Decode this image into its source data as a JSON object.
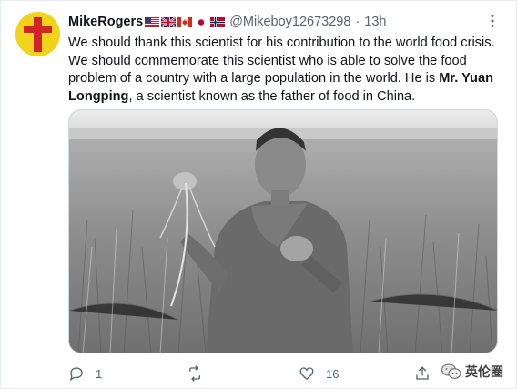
{
  "tweet": {
    "display_name": "MikeRogers",
    "flags": [
      "us-flag",
      "uk-flag",
      "canada-flag",
      "japan-flag",
      "norway-flag"
    ],
    "handle": "@Mikeboy12673298",
    "separator": "·",
    "time": "13h",
    "text_part1": "We should thank this scientist for his contribution to the world food crisis. We should commemorate this scientist who is able to solve the food problem of a country with a large population in the world. He is ",
    "text_bold": "Mr. Yuan Longping",
    "text_part2": ", a scientist known as the father of food in China.",
    "reply_count": "1",
    "retweet_count": "",
    "like_count": "16"
  },
  "watermark": {
    "text": "英伦圈",
    "icon": "wechat-icon"
  },
  "colors": {
    "secondary_text": "#536471",
    "avatar_bg": "#f2d31b",
    "avatar_cross": "#d2232a"
  }
}
